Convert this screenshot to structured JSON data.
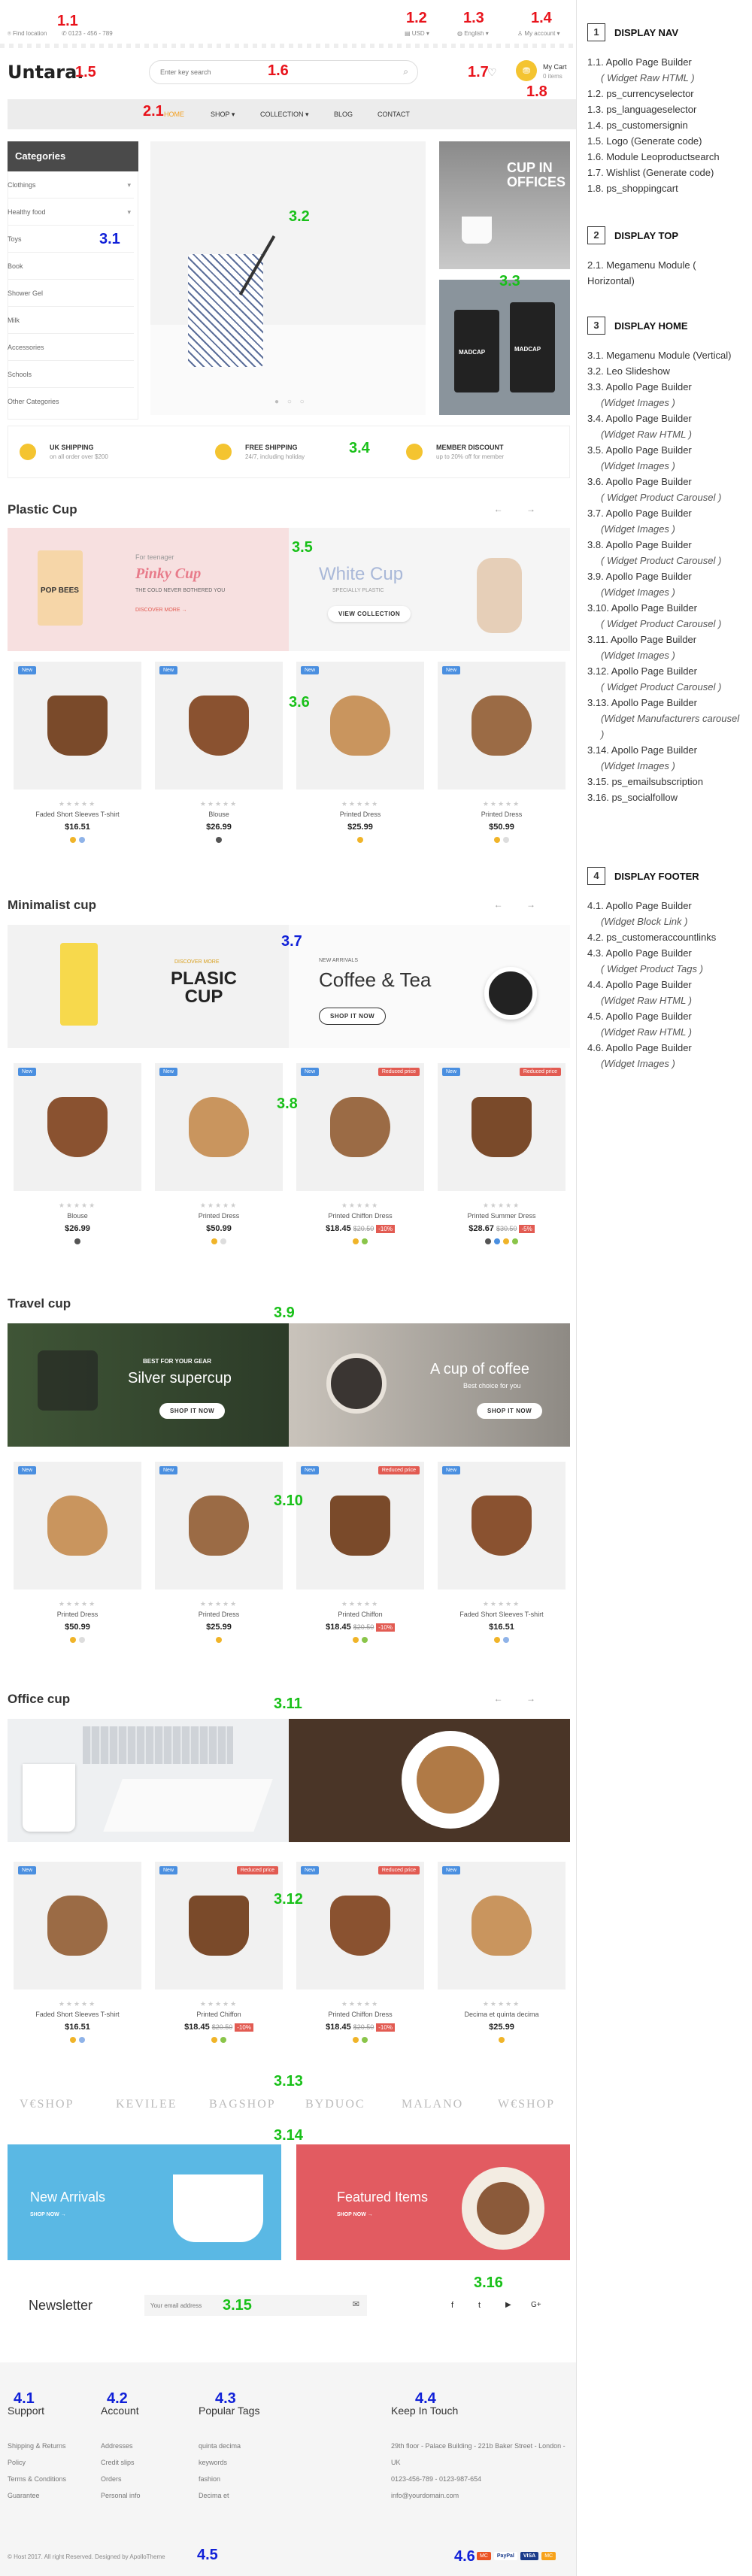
{
  "nav": {
    "find_location": "Find location",
    "phone": "0123 - 456 - 789",
    "currency": "USD",
    "language": "English",
    "account": "My account"
  },
  "header": {
    "logo": "Untara.",
    "search_placeholder": "Enter key search",
    "cart_label": "My Cart",
    "cart_items": "0 items"
  },
  "menu": [
    "HOME",
    "SHOP",
    "COLLECTION",
    "BLOG",
    "CONTACT"
  ],
  "categories": {
    "title": "Categories",
    "items": [
      "Clothings",
      "Healthy food",
      "Toys",
      "Book",
      "Shower Gel",
      "Milk",
      "Accessories",
      "Schools",
      "Other Categories"
    ]
  },
  "slider_side": {
    "banner_text": "CUP IN OFFICES",
    "cup_brand": "MADCAP"
  },
  "services": [
    {
      "title": "UK SHIPPING",
      "sub": "on all order over $200"
    },
    {
      "title": "FREE SHIPPING",
      "sub": "24/7, including holiday"
    },
    {
      "title": "MEMBER DISCOUNT",
      "sub": "up to 20% off for member"
    }
  ],
  "sections": [
    {
      "title": "Plastic Cup",
      "banners": [
        {
          "kicker": "For teenager",
          "title": "Pinky Cup",
          "sub": "THE COLD NEVER BOTHERED YOU",
          "cta": "DISCOVER MORE →",
          "cup_text": "POP BEES"
        },
        {
          "title": "White Cup",
          "sub": "SPECIALLY PLASTIC",
          "cta": "VIEW COLLECTION"
        }
      ],
      "products": [
        {
          "badge": "New",
          "name": "Faded Short Sleeves T-shirt",
          "price": "$16.51",
          "old": "",
          "disc": "",
          "colors": [
            "#f0b429",
            "#8fb3e8"
          ]
        },
        {
          "badge": "New",
          "name": "Blouse",
          "price": "$26.99",
          "old": "",
          "disc": "",
          "colors": [
            "#555555"
          ]
        },
        {
          "badge": "New",
          "name": "Printed Dress",
          "price": "$25.99",
          "old": "",
          "disc": "",
          "colors": [
            "#f0b429"
          ]
        },
        {
          "badge": "New",
          "name": "Printed Dress",
          "price": "$50.99",
          "old": "",
          "disc": "",
          "colors": [
            "#f0b429",
            "#dddddd"
          ]
        }
      ]
    },
    {
      "title": "Minimalist cup",
      "banners": [
        {
          "kicker": "DISCOVER MORE",
          "title": "PLASIC CUP"
        },
        {
          "kicker": "NEW ARRIVALS",
          "title": "Coffee & Tea",
          "cta": "SHOP IT NOW"
        }
      ],
      "products": [
        {
          "badge": "New",
          "name": "Blouse",
          "price": "$26.99",
          "old": "",
          "disc": "",
          "colors": [
            "#555555"
          ]
        },
        {
          "badge": "New",
          "name": "Printed Dress",
          "price": "$50.99",
          "old": "",
          "disc": "",
          "colors": [
            "#f0b429",
            "#dddddd"
          ]
        },
        {
          "badge": "New",
          "badge2": "Reduced price",
          "name": "Printed Chiffon Dress",
          "price": "$18.45",
          "old": "$20.50",
          "disc": "-10%",
          "colors": [
            "#f0b429",
            "#8ac54a"
          ]
        },
        {
          "badge": "New",
          "badge2": "Reduced price",
          "name": "Printed Summer Dress",
          "price": "$28.67",
          "old": "$30.50",
          "disc": "-5%",
          "colors": [
            "#555555",
            "#4a8fe0",
            "#f0b429",
            "#8ac54a"
          ]
        }
      ]
    },
    {
      "title": "Travel cup",
      "banners": [
        {
          "kicker": "BEST FOR YOUR GEAR",
          "title": "Silver supercup",
          "cta": "SHOP IT NOW"
        },
        {
          "title": "A cup of coffee",
          "sub": "Best choice for you",
          "cta": "SHOP IT NOW"
        }
      ],
      "products": [
        {
          "badge": "New",
          "name": "Printed Dress",
          "price": "$50.99",
          "old": "",
          "disc": "",
          "colors": [
            "#f0b429",
            "#dddddd"
          ]
        },
        {
          "badge": "New",
          "name": "Printed Dress",
          "price": "$25.99",
          "old": "",
          "disc": "",
          "colors": [
            "#f0b429"
          ]
        },
        {
          "badge": "New",
          "badge2": "Reduced price",
          "name": "Printed Chiffon",
          "price": "$18.45",
          "old": "$20.50",
          "disc": "-10%",
          "colors": [
            "#f0b429",
            "#8ac54a"
          ]
        },
        {
          "badge": "New",
          "name": "Faded Short Sleeves T-shirt",
          "price": "$16.51",
          "old": "",
          "disc": "",
          "colors": [
            "#f0b429",
            "#8fb3e8"
          ]
        }
      ]
    },
    {
      "title": "Office cup",
      "banners": [
        {},
        {}
      ],
      "products": [
        {
          "badge": "New",
          "name": "Faded Short Sleeves T-shirt",
          "price": "$16.51",
          "old": "",
          "disc": "",
          "colors": [
            "#f0b429",
            "#8fb3e8"
          ]
        },
        {
          "badge": "New",
          "badge2": "Reduced price",
          "name": "Printed Chiffon",
          "price": "$18.45",
          "old": "$20.50",
          "disc": "-10%",
          "colors": [
            "#f0b429",
            "#8ac54a"
          ]
        },
        {
          "badge": "New",
          "badge2": "Reduced price",
          "name": "Printed Chiffon Dress",
          "price": "$18.45",
          "old": "$20.50",
          "disc": "-10%",
          "colors": [
            "#f0b429",
            "#8ac54a"
          ]
        },
        {
          "badge": "New",
          "name": "Decima et quinta decima",
          "price": "$25.99",
          "old": "",
          "disc": "",
          "colors": [
            "#f0b429"
          ]
        }
      ]
    }
  ],
  "brands": [
    "V€SHOP",
    "KEVILEE",
    "BAGSHOP",
    "BYDUOC",
    "MALANO",
    "W€SHOP"
  ],
  "promo": [
    {
      "title": "New Arrivals",
      "cta": "SHOP NOW →"
    },
    {
      "title": "Featured Items",
      "cta": "SHOP NOW →"
    }
  ],
  "newsletter": {
    "title": "Newsletter",
    "placeholder": "Your email address"
  },
  "social": [
    "f",
    "t",
    "▶",
    "G+"
  ],
  "footer": {
    "cols": [
      {
        "title": "Support",
        "items": [
          "Shipping & Returns",
          "Policy",
          "Terms & Conditions",
          "Guarantee"
        ]
      },
      {
        "title": "Account",
        "items": [
          "Addresses",
          "Credit slips",
          "Orders",
          "Personal info"
        ]
      },
      {
        "title": "Popular Tags",
        "items": [
          "quinta decima",
          "keywords",
          "fashion",
          "Decima et"
        ]
      },
      {
        "title": "Keep In Touch",
        "items": [
          "29th floor - Palace Building - 221b Baker Street - London - UK",
          "0123-456-789 - 0123-987-654",
          "info@yourdomain.com"
        ]
      }
    ],
    "copyright": "© Host 2017. All right Reserved. Designed by ApolloTheme",
    "payments": [
      "MC",
      "PayPal",
      "VISA",
      "MC"
    ]
  },
  "tags": {
    "n11": "1.1",
    "n12": "1.2",
    "n13": "1.3",
    "n14": "1.4",
    "n15": "1.5",
    "n16": "1.6",
    "n17": "1.7",
    "n18": "1.8",
    "n21": "2.1",
    "n31": "3.1",
    "n32": "3.2",
    "n33": "3.3",
    "n34": "3.4",
    "n35": "3.5",
    "n36": "3.6",
    "n37": "3.7",
    "n38": "3.8",
    "n39": "3.9",
    "n310": "3.10",
    "n311": "3.11",
    "n312": "3.12",
    "n313": "3.13",
    "n314": "3.14",
    "n315": "3.15",
    "n316": "3.16",
    "n41": "4.1",
    "n42": "4.2",
    "n43": "4.3",
    "n44": "4.4",
    "n45": "4.5",
    "n46": "4.6"
  },
  "sidebar": [
    {
      "num": "1",
      "title": "DISPLAY NAV",
      "items": [
        {
          "t": "1.1. Apollo Page Builder",
          "sub": false
        },
        {
          "t": "( Widget Raw HTML )",
          "sub": true
        },
        {
          "t": "1.2. ps_currencyselector",
          "sub": false
        },
        {
          "t": "1.3. ps_languageselector",
          "sub": false
        },
        {
          "t": "1.4. ps_customersignin",
          "sub": false
        },
        {
          "t": "1.5. Logo (Generate code)",
          "sub": false
        },
        {
          "t": "1.6. Module Leoproductsearch",
          "sub": false
        },
        {
          "t": "1.7. Wishlist (Generate code)",
          "sub": false
        },
        {
          "t": "1.8. ps_shoppingcart",
          "sub": false
        }
      ]
    },
    {
      "num": "2",
      "title": "DISPLAY TOP",
      "items": [
        {
          "t": "2.1. Megamenu Module ( Horizontal)",
          "sub": false
        }
      ]
    },
    {
      "num": "3",
      "title": "DISPLAY HOME",
      "items": [
        {
          "t": "3.1. Megamenu Module (Vertical)",
          "sub": false
        },
        {
          "t": "3.2. Leo Slideshow",
          "sub": false
        },
        {
          "t": "3.3. Apollo Page Builder",
          "sub": false
        },
        {
          "t": "(Widget Images )",
          "sub": true
        },
        {
          "t": "3.4. Apollo Page Builder",
          "sub": false
        },
        {
          "t": "(Widget Raw HTML )",
          "sub": true
        },
        {
          "t": "3.5. Apollo Page Builder",
          "sub": false
        },
        {
          "t": "(Widget Images )",
          "sub": true
        },
        {
          "t": "3.6. Apollo Page Builder",
          "sub": false
        },
        {
          "t": "( Widget Product Carousel )",
          "sub": true
        },
        {
          "t": "3.7. Apollo Page Builder",
          "sub": false
        },
        {
          "t": "(Widget Images )",
          "sub": true
        },
        {
          "t": "3.8. Apollo Page Builder",
          "sub": false
        },
        {
          "t": "( Widget Product Carousel )",
          "sub": true
        },
        {
          "t": "3.9. Apollo Page Builder",
          "sub": false
        },
        {
          "t": "(Widget Images )",
          "sub": true
        },
        {
          "t": "3.10. Apollo Page Builder",
          "sub": false
        },
        {
          "t": "( Widget Product Carousel )",
          "sub": true
        },
        {
          "t": "3.11. Apollo Page Builder",
          "sub": false
        },
        {
          "t": "(Widget Images )",
          "sub": true
        },
        {
          "t": "3.12. Apollo Page Builder",
          "sub": false
        },
        {
          "t": "( Widget Product Carousel )",
          "sub": true
        },
        {
          "t": "3.13. Apollo Page Builder",
          "sub": false
        },
        {
          "t": "(Widget Manufacturers carousel )",
          "sub": true
        },
        {
          "t": "3.14. Apollo Page Builder",
          "sub": false
        },
        {
          "t": "(Widget Images )",
          "sub": true
        },
        {
          "t": "3.15. ps_emailsubscription",
          "sub": false
        },
        {
          "t": "3.16. ps_socialfollow",
          "sub": false
        }
      ]
    },
    {
      "num": "4",
      "title": "DISPLAY FOOTER",
      "items": [
        {
          "t": "4.1. Apollo Page Builder",
          "sub": false
        },
        {
          "t": "(Widget Block Link )",
          "sub": true
        },
        {
          "t": "4.2. ps_customeraccountlinks",
          "sub": false
        },
        {
          "t": "4.3. Apollo Page Builder",
          "sub": false
        },
        {
          "t": "( Widget Product Tags )",
          "sub": true
        },
        {
          "t": "4.4. Apollo Page Builder",
          "sub": false
        },
        {
          "t": "(Widget Raw HTML )",
          "sub": true
        },
        {
          "t": "4.5. Apollo Page Builder",
          "sub": false
        },
        {
          "t": "(Widget Raw HTML )",
          "sub": true
        },
        {
          "t": "4.6. Apollo Page Builder",
          "sub": false
        },
        {
          "t": "(Widget Images )",
          "sub": true
        }
      ]
    }
  ],
  "colors": {
    "accent": "#f4c430",
    "tag_red": "#e8131b",
    "tag_green": "#18c018",
    "tag_blue": "#1020d8",
    "badge_new": "#4a8fe0",
    "badge_sale": "#e25b52"
  }
}
